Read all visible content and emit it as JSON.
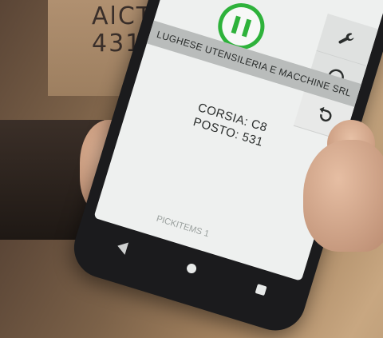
{
  "background": {
    "box_line1": "AlCT",
    "box_line2": "4317"
  },
  "app": {
    "status": {
      "pause_icon": "pause-icon",
      "accent": "#2eb23b"
    },
    "company_name": "LUGHESE UTENSILERIA E MACCHINE SRL",
    "location": {
      "corsia_label": "CORSIA:",
      "corsia_value": "C8",
      "posto_label": "POSTO:",
      "posto_value": "531"
    },
    "footer_label": "PICKITEMS 1",
    "side_buttons": [
      {
        "icon": "wrench-icon"
      },
      {
        "icon": "headset-icon"
      },
      {
        "icon": "undo-icon"
      }
    ]
  },
  "system_nav": {
    "back_icon": "back-icon",
    "home_icon": "home-icon",
    "recent_icon": "recent-apps-icon"
  }
}
